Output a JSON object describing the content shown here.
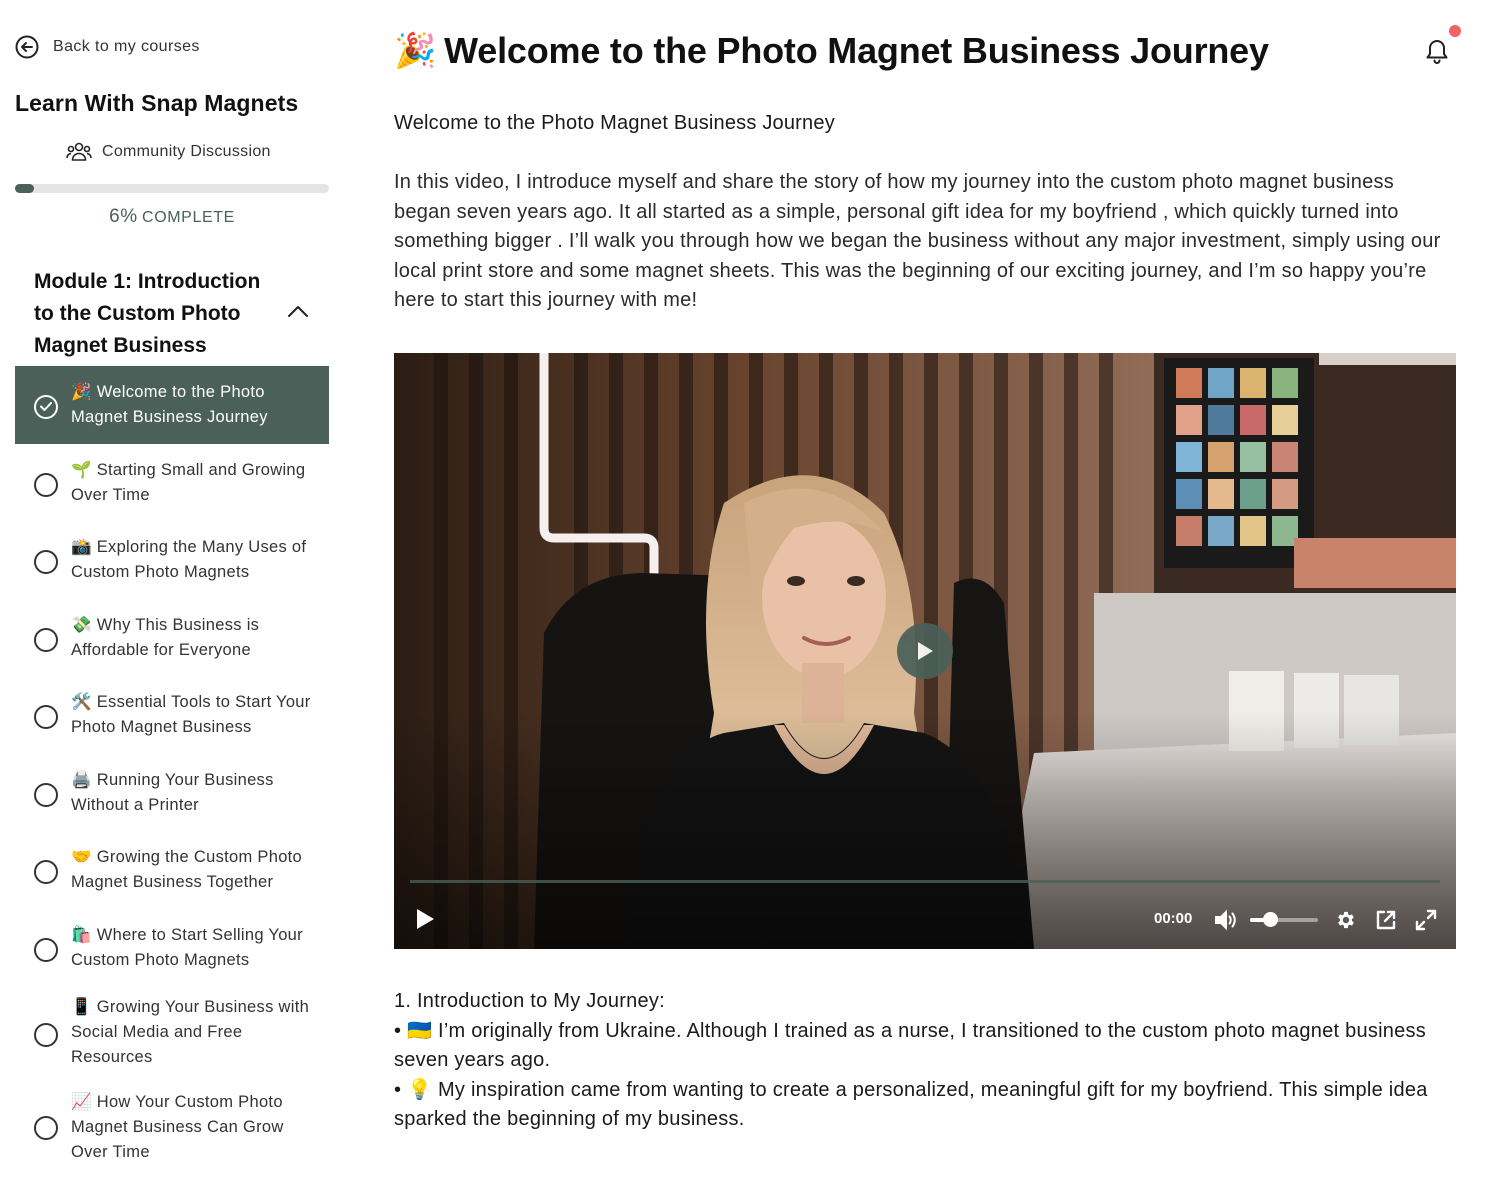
{
  "sidebar": {
    "back_label": "Back to my courses",
    "course_title": "Learn With Snap Magnets",
    "community_label": "Community Discussion",
    "progress": {
      "percent": 6,
      "percent_label": "6%",
      "complete_label": "COMPLETE"
    },
    "module": {
      "title": "Module 1: Introduction to the Custom Photo Magnet Business",
      "expanded": true
    },
    "lessons": [
      {
        "label": "🎉 Welcome to the Photo Magnet Business Journey",
        "active": true,
        "completed": true
      },
      {
        "label": "🌱 Starting Small and Growing Over Time",
        "active": false,
        "completed": false
      },
      {
        "label": "📸 Exploring the Many Uses of Custom Photo Magnets",
        "active": false,
        "completed": false
      },
      {
        "label": "💸 Why This Business is Affordable for Everyone",
        "active": false,
        "completed": false
      },
      {
        "label": "🛠️ Essential Tools to Start Your Photo Magnet Business",
        "active": false,
        "completed": false
      },
      {
        "label": "🖨️ Running Your Business Without a Printer",
        "active": false,
        "completed": false
      },
      {
        "label": "🤝 Growing the Custom Photo Magnet Business Together",
        "active": false,
        "completed": false
      },
      {
        "label": "🛍️ Where to Start Selling Your Custom Photo Magnets",
        "active": false,
        "completed": false
      },
      {
        "label": "📱 Growing Your Business with Social Media and Free Resources",
        "active": false,
        "completed": false
      },
      {
        "label": "📈 How Your Custom Photo Magnet Business Can Grow Over Time",
        "active": false,
        "completed": false
      }
    ]
  },
  "main": {
    "title_emoji": "🎉",
    "title": "Welcome to the Photo Magnet Business Journey",
    "subtitle": "Welcome to the Photo Magnet Business Journey",
    "description": "In this video, I introduce myself and share the story of how my journey into the custom photo magnet business began seven years ago. It all started as a simple, personal gift idea for my boyfriend , which quickly turned into something bigger . I’ll walk you through how we began the business without any major investment, simply using our local print store and some magnet sheets. This was the beginning of our exciting journey, and I’m so happy you’re here to start this journey with me!",
    "video": {
      "time": "00:00",
      "volume": 0.3
    },
    "section_heading": "1. Introduction to My Journey:",
    "bullets": [
      "• 🇺🇦 I’m originally from Ukraine. Although I trained as a nurse, I transitioned to the custom photo magnet business seven years ago.",
      "• 💡 My inspiration came from wanting to create a personalized, meaningful gift for my boyfriend. This simple idea sparked the beginning of my business."
    ]
  },
  "colors": {
    "accent": "#4a6058",
    "notification_dot": "#ef6464",
    "progress_track": "#e4e4e4"
  },
  "icons": {
    "back": "arrow-left-circle-icon",
    "community": "users-icon",
    "collapse": "chevron-up-icon",
    "lesson_done": "check-circle-icon",
    "lesson_todo": "empty-circle-icon",
    "notifications": "bell-icon",
    "play": "play-icon",
    "volume": "volume-icon",
    "settings": "gear-icon",
    "popout": "external-link-icon",
    "fullscreen": "fullscreen-icon"
  }
}
